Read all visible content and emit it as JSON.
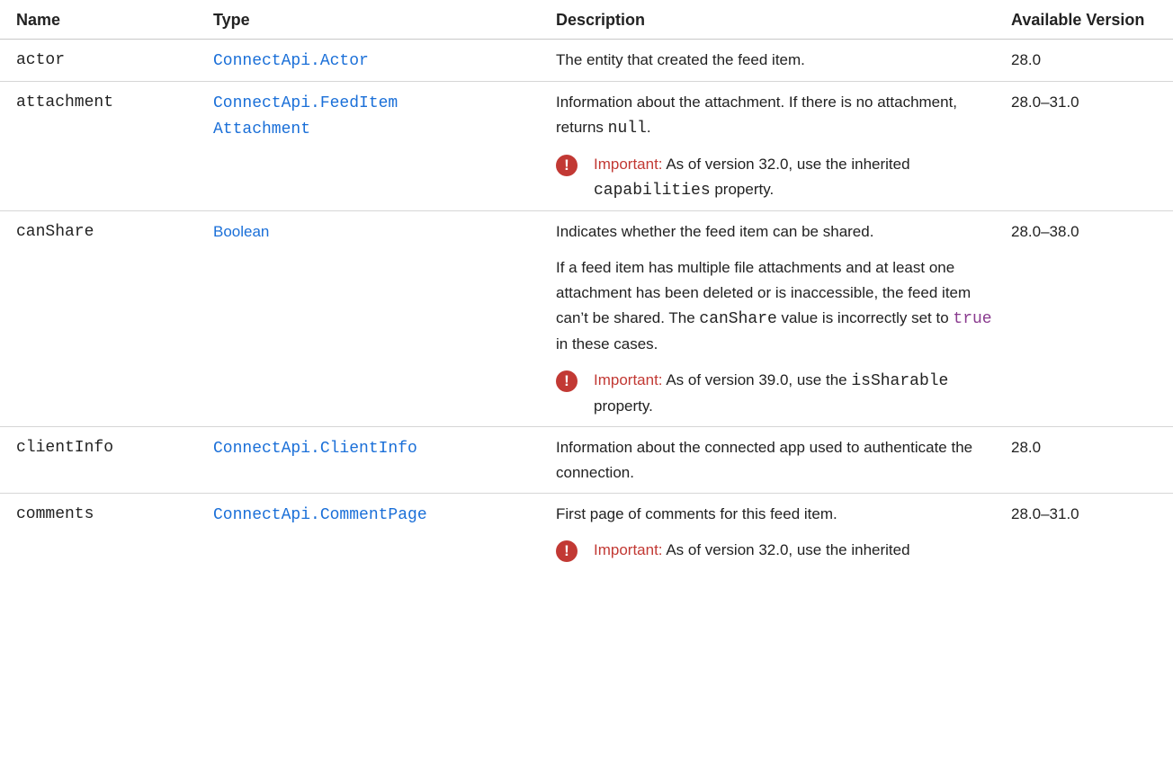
{
  "headers": {
    "name": "Name",
    "type": "Type",
    "description": "Description",
    "version": "Available Version"
  },
  "rows": [
    {
      "name": "actor",
      "type": "ConnectApi.Actor",
      "desc": "The entity that created the feed item.",
      "version": "28.0"
    },
    {
      "name": "attachment",
      "type_line1": "ConnectApi.FeedItem",
      "type_line2": "Attachment",
      "desc_pre": "Information about the attachment. If there is no attachment, returns ",
      "desc_code": "null",
      "desc_post": ".",
      "note_label": "Important:",
      "note_pre": " As of version 32.0, use the inherited ",
      "note_code": "capabilities",
      "note_post": " property.",
      "version": "28.0–31.0"
    },
    {
      "name": "canShare",
      "type": "Boolean",
      "desc1": "Indicates whether the feed item can be shared.",
      "desc2_pre": "If a feed item has multiple file attachments and at least one attachment has been deleted or is inaccessible, the feed item can’t be shared. The ",
      "desc2_code": "canShare",
      "desc2_mid": " value is incorrectly set to ",
      "desc2_code2": "true",
      "desc2_post": " in these cases.",
      "note_label": "Important:",
      "note_pre": " As of version 39.0, use the ",
      "note_code": "isSharable",
      "note_post": " property.",
      "version": "28.0–38.0"
    },
    {
      "name": "clientInfo",
      "type": "ConnectApi.ClientInfo",
      "desc": "Information about the connected app used to authenticate the connection.",
      "version": "28.0"
    },
    {
      "name": "comments",
      "type": "ConnectApi.CommentPage",
      "desc": "First page of comments for this feed item.",
      "note_label": "Important:",
      "note_pre": " As of version 32.0, use the inherited",
      "version": "28.0–31.0"
    }
  ],
  "icons": {
    "important": "!"
  },
  "colors": {
    "link": "#1a6fd8",
    "important": "#c23934",
    "code_literal": "#8a3b8f"
  }
}
